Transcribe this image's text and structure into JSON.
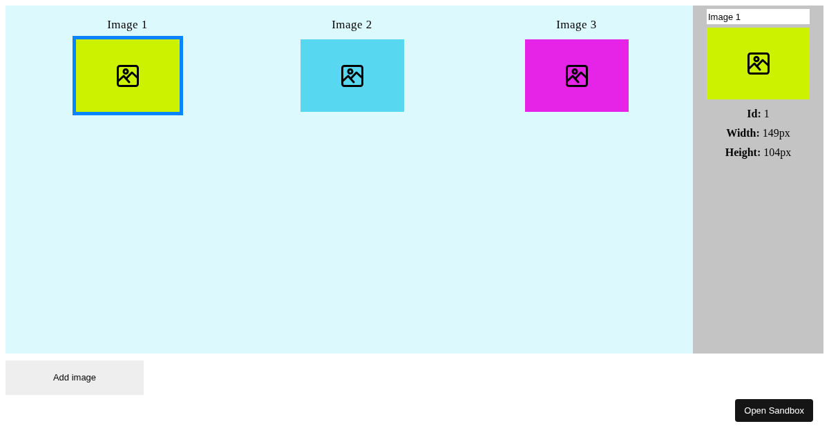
{
  "canvas": {
    "images": [
      {
        "title": "Image 1",
        "color": "#ccf200",
        "selected": true
      },
      {
        "title": "Image 2",
        "color": "#57d8f0",
        "selected": false
      },
      {
        "title": "Image 3",
        "color": "#e524e8",
        "selected": false
      }
    ]
  },
  "inspector": {
    "name_field": {
      "value": "Image 1"
    },
    "properties": [
      "**Id:** 1",
      "**Width:** 149px",
      "**Height:** 104px"
    ]
  },
  "add_button": {
    "label": "Add image"
  },
  "sandbox_button": {
    "label": "Open Sandbox"
  }
}
